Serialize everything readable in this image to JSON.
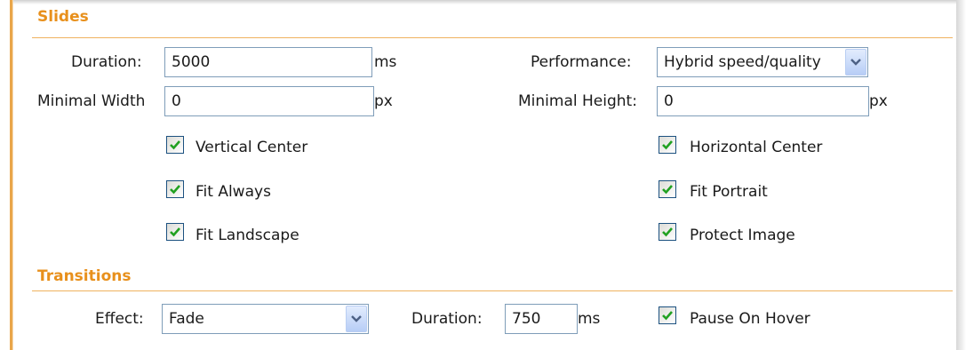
{
  "slides": {
    "title": "Slides",
    "duration": {
      "label": "Duration:",
      "value": "5000",
      "unit": "ms"
    },
    "performance": {
      "label": "Performance:",
      "value": "Hybrid speed/quality"
    },
    "min_width": {
      "label": "Minimal Width",
      "value": "0",
      "unit": "px"
    },
    "min_height": {
      "label": "Minimal Height:",
      "value": "0",
      "unit": "px"
    },
    "checkboxes": {
      "vertical_center": {
        "label": "Vertical Center",
        "checked": true
      },
      "horizontal_center": {
        "label": "Horizontal Center",
        "checked": true
      },
      "fit_always": {
        "label": "Fit Always",
        "checked": true
      },
      "fit_portrait": {
        "label": "Fit Portrait",
        "checked": true
      },
      "fit_landscape": {
        "label": "Fit Landscape",
        "checked": true
      },
      "protect_image": {
        "label": "Protect Image",
        "checked": true
      }
    }
  },
  "transitions": {
    "title": "Transitions",
    "effect": {
      "label": "Effect:",
      "value": "Fade"
    },
    "duration": {
      "label": "Duration:",
      "value": "750",
      "unit": "ms"
    },
    "pause_on_hover": {
      "label": "Pause On Hover",
      "checked": true
    }
  },
  "colors": {
    "accent": "#e8901c",
    "check": "#21a121",
    "input_border": "#7f9db9"
  },
  "icons": {
    "dropdown": "chevron-down-icon",
    "check": "checkmark-icon"
  }
}
